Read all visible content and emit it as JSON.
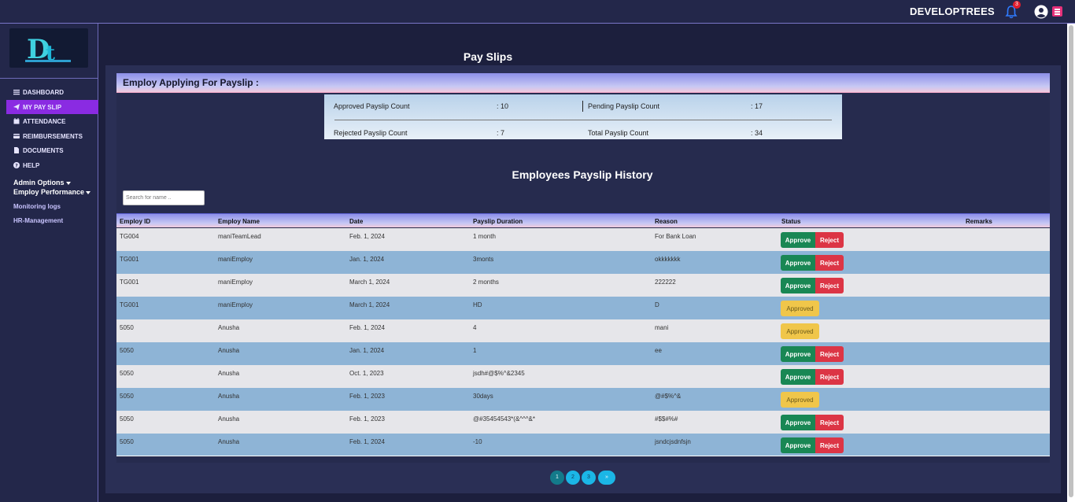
{
  "header": {
    "brand": "DEVELOPTREES",
    "notification_count": "3"
  },
  "sidebar": {
    "logo_text": "Dt",
    "items": [
      {
        "label": "DASHBOARD"
      },
      {
        "label": "MY PAY SLIP"
      },
      {
        "label": "ATTENDANCE"
      },
      {
        "label": "REIMBURSEMENTS"
      },
      {
        "label": "DOCUMENTS"
      },
      {
        "label": "HELP"
      }
    ],
    "admin_options": "Admin Options",
    "employ_performance": "Employ Performance",
    "monitoring_logs": "Monitoring logs",
    "hr_management": "HR-Management"
  },
  "page": {
    "title": "Pay Slips",
    "card_header": "Employ Applying For Payslip :"
  },
  "counts": {
    "approved_label": "Approved Payslip Count",
    "approved_value": ": 10",
    "pending_label": "Pending Payslip Count",
    "pending_value": ": 17",
    "rejected_label": "Rejected Payslip Count",
    "rejected_value": ": 7",
    "total_label": "Total Payslip Count",
    "total_value": ": 34"
  },
  "history": {
    "title": "Employees Payslip History",
    "search_placeholder": "Search for name ..",
    "columns": [
      "Employ ID",
      "Employ Name",
      "Date",
      "Payslip Duration",
      "Reason",
      "Status",
      "Remarks"
    ],
    "rows": [
      {
        "id": "TG004",
        "name": "maniTeamLead",
        "date": "Feb. 1, 2024",
        "duration": "1 month",
        "reason": "For Bank Loan",
        "status": "pending"
      },
      {
        "id": "TG001",
        "name": "maniEmploy",
        "date": "Jan. 1, 2024",
        "duration": "3monts",
        "reason": "okkkkkkk",
        "status": "pending"
      },
      {
        "id": "TG001",
        "name": "maniEmploy",
        "date": "March 1, 2024",
        "duration": "2 months",
        "reason": "222222",
        "status": "pending"
      },
      {
        "id": "TG001",
        "name": "maniEmploy",
        "date": "March 1, 2024",
        "duration": "HD",
        "reason": "D",
        "status": "approved"
      },
      {
        "id": "5050",
        "name": "Anusha",
        "date": "Feb. 1, 2024",
        "duration": "4",
        "reason": "mani",
        "status": "approved"
      },
      {
        "id": "5050",
        "name": "Anusha",
        "date": "Jan. 1, 2024",
        "duration": "1",
        "reason": "ee",
        "status": "pending"
      },
      {
        "id": "5050",
        "name": "Anusha",
        "date": "Oct. 1, 2023",
        "duration": "jsdh#@$%^&2345",
        "reason": "",
        "status": "pending"
      },
      {
        "id": "5050",
        "name": "Anusha",
        "date": "Feb. 1, 2023",
        "duration": "30days",
        "reason": "@#$%^&",
        "status": "approved"
      },
      {
        "id": "5050",
        "name": "Anusha",
        "date": "Feb. 1, 2023",
        "duration": "@#35454543*(&^^^&*",
        "reason": "#$$#%#",
        "status": "pending"
      },
      {
        "id": "5050",
        "name": "Anusha",
        "date": "Feb. 1, 2024",
        "duration": "-10",
        "reason": "jsndcjsdnfsjn",
        "status": "pending"
      }
    ],
    "approve_label": "Approve",
    "reject_label": "Reject",
    "approved_label": "Approved"
  },
  "pagination": {
    "pages": [
      "1",
      "2",
      "3"
    ],
    "next": "»"
  },
  "colors": {
    "approve": "#198754",
    "reject": "#dc3545",
    "approved": "#f0c64a",
    "active_nav": "#8a2be2"
  }
}
